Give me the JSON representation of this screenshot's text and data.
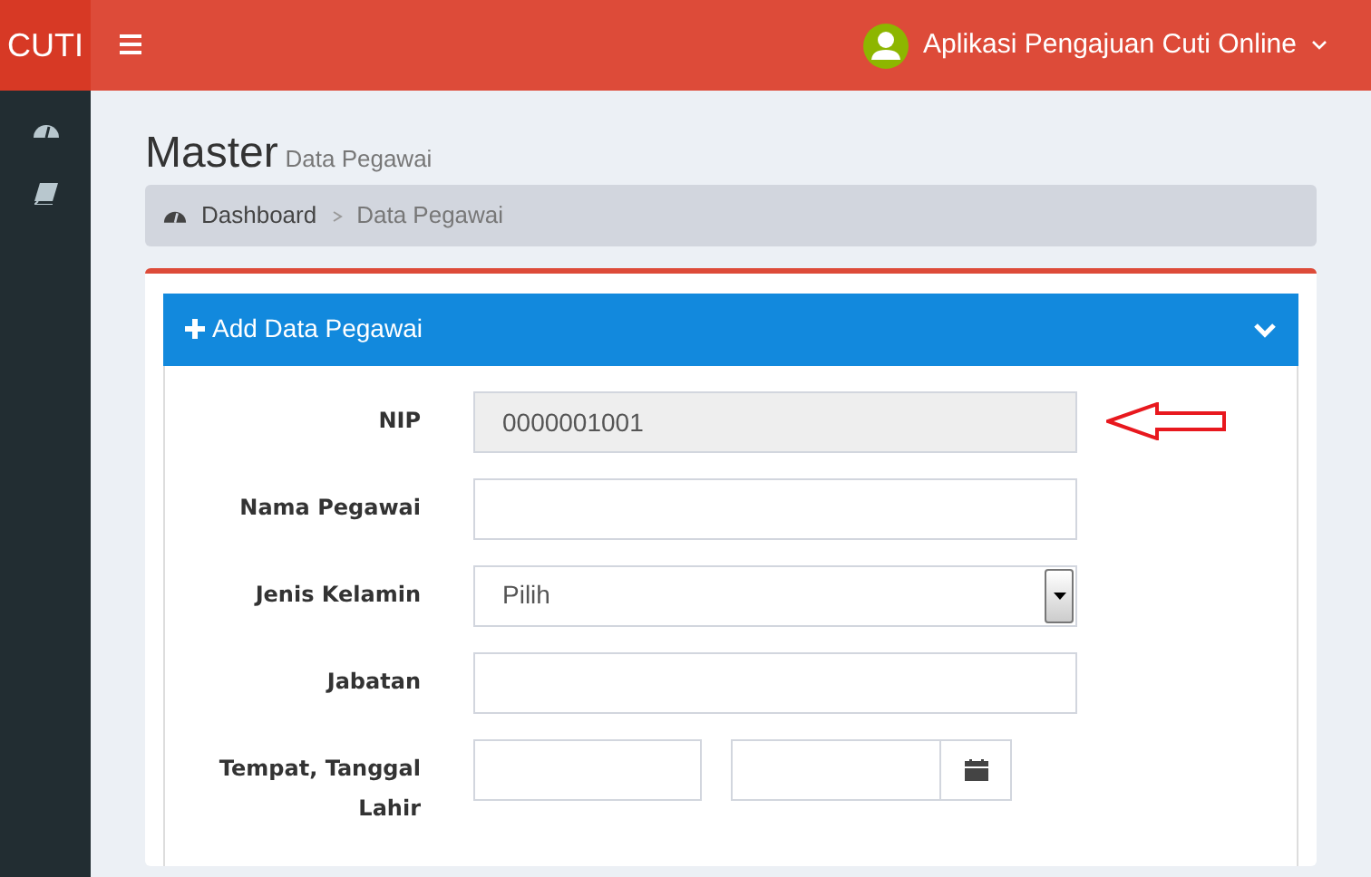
{
  "header": {
    "logo": "CUTI",
    "app_title": "Aplikasi Pengajuan Cuti Online"
  },
  "page": {
    "title": "Master",
    "subtitle": "Data Pegawai"
  },
  "breadcrumb": [
    {
      "label": "Dashboard"
    },
    {
      "label": "Data Pegawai"
    }
  ],
  "panel": {
    "title": "Add Data Pegawai",
    "expanded": true
  },
  "fields": [
    {
      "kind": "text",
      "label": "NIP",
      "value": "0000001001",
      "disabled": true,
      "annotated": true
    },
    {
      "kind": "text",
      "label": "Nama Pegawai",
      "disabled": false,
      "annotated": false
    },
    {
      "kind": "select",
      "label": "Jenis Kelamin",
      "value": "Pilih",
      "disabled": false,
      "annotated": false
    },
    {
      "kind": "text",
      "label": "Jabatan",
      "disabled": false,
      "annotated": false
    },
    {
      "kind": "place-date",
      "label": "Tempat, Tanggal Lahir",
      "disabled": false,
      "annotated": false
    }
  ]
}
